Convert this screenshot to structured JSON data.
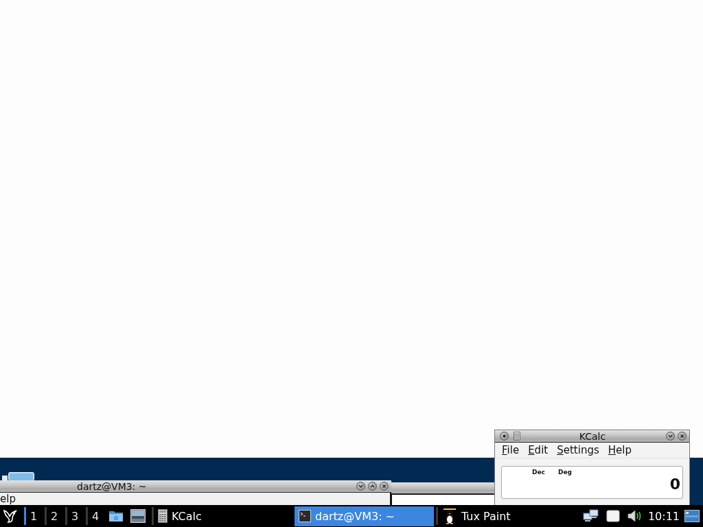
{
  "terminal_window": {
    "title": "dartz@VM3: ~",
    "menu": [
      "elp"
    ]
  },
  "kcalc_window": {
    "title": "KCalc",
    "menu": [
      "File",
      "Edit",
      "Settings",
      "Help"
    ],
    "display": {
      "indicators": [
        "Dec",
        "Deg"
      ],
      "value": "0"
    }
  },
  "taskbar": {
    "workspaces": [
      {
        "label": "1",
        "selected": true
      },
      {
        "label": "2",
        "selected": false
      },
      {
        "label": "3",
        "selected": false
      },
      {
        "label": "4",
        "selected": false
      }
    ],
    "tasks": [
      {
        "kind": "calculator",
        "label": "KCalc",
        "selected": false
      },
      {
        "kind": "terminal",
        "label": "dartz@VM3: ~",
        "selected": true
      },
      {
        "kind": "paint",
        "label": "Tux Paint",
        "selected": false
      }
    ],
    "clock": "10:11"
  }
}
